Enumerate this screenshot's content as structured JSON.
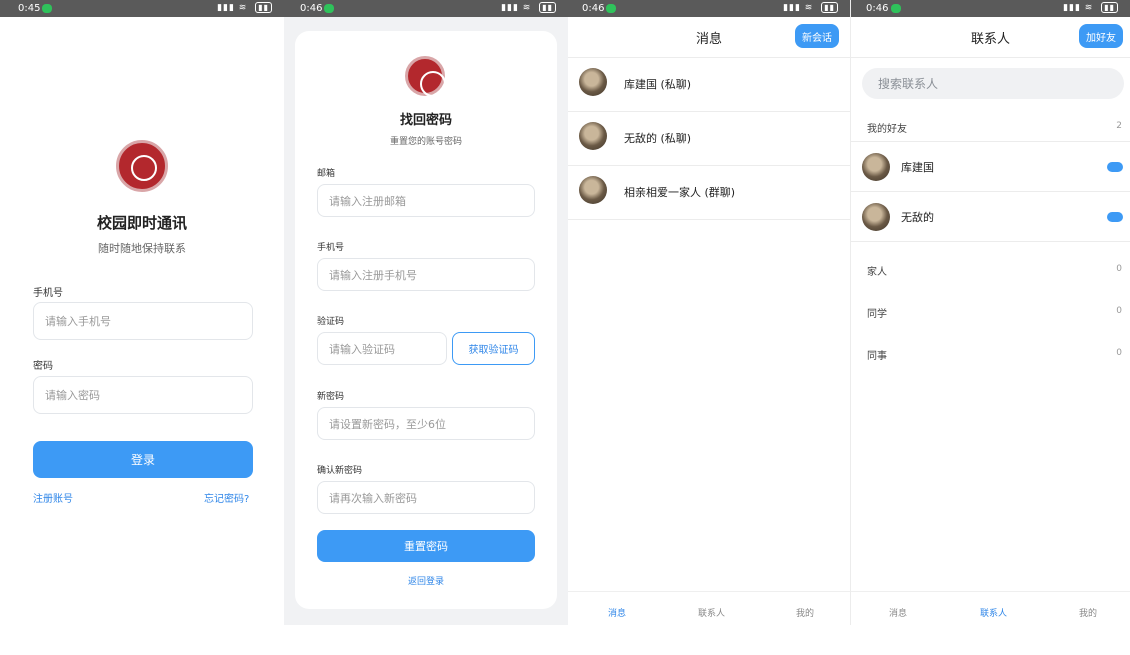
{
  "screens": {
    "login": {
      "status_time": "0:45",
      "title": "校园即时通讯",
      "subtitle": "随时随地保持联系",
      "phone_label": "手机号",
      "phone_placeholder": "请输入手机号",
      "password_label": "密码",
      "password_placeholder": "请输入密码",
      "login_button": "登录",
      "register_link": "注册账号",
      "forgot_link": "忘记密码?"
    },
    "recover": {
      "status_time": "0:46",
      "title": "找回密码",
      "subtitle": "重置您的账号密码",
      "email_label": "邮箱",
      "email_placeholder": "请输入注册邮箱",
      "phone_label": "手机号",
      "phone_placeholder": "请输入注册手机号",
      "code_label": "验证码",
      "code_placeholder": "请输入验证码",
      "get_code_button": "获取验证码",
      "new_password_label": "新密码",
      "new_password_placeholder": "请设置新密码，至少6位",
      "confirm_label": "确认新密码",
      "confirm_placeholder": "请再次输入新密码",
      "reset_button": "重置密码",
      "back_link": "返回登录"
    },
    "messages": {
      "status_time": "0:46",
      "title": "消息",
      "new_chat_button": "新会话",
      "conversations": [
        {
          "name": "库建国 (私聊)"
        },
        {
          "name": "无敌的 (私聊)"
        },
        {
          "name": "相亲相爱一家人 (群聊)"
        }
      ],
      "tabs": [
        "消息",
        "联系人",
        "我的"
      ]
    },
    "contacts": {
      "status_time": "0:46",
      "title": "联系人",
      "add_friend_button": "加好友",
      "search_placeholder": "搜索联系人",
      "groups": [
        {
          "label": "我的好友",
          "count": "2"
        },
        {
          "label": "家人",
          "count": "0"
        },
        {
          "label": "同学",
          "count": "0"
        },
        {
          "label": "同事",
          "count": "0"
        }
      ],
      "friends": [
        {
          "name": "库建国"
        },
        {
          "name": "无敌的"
        }
      ],
      "tabs": [
        "消息",
        "联系人",
        "我的"
      ]
    }
  },
  "colors": {
    "accent": "#3d9af5",
    "link": "#2f86e8",
    "status_bar": "#5a5a5a"
  },
  "icons": [
    "wechat-notification-icon",
    "signal-icon",
    "wifi-icon",
    "battery-icon",
    "school-logo-icon"
  ]
}
